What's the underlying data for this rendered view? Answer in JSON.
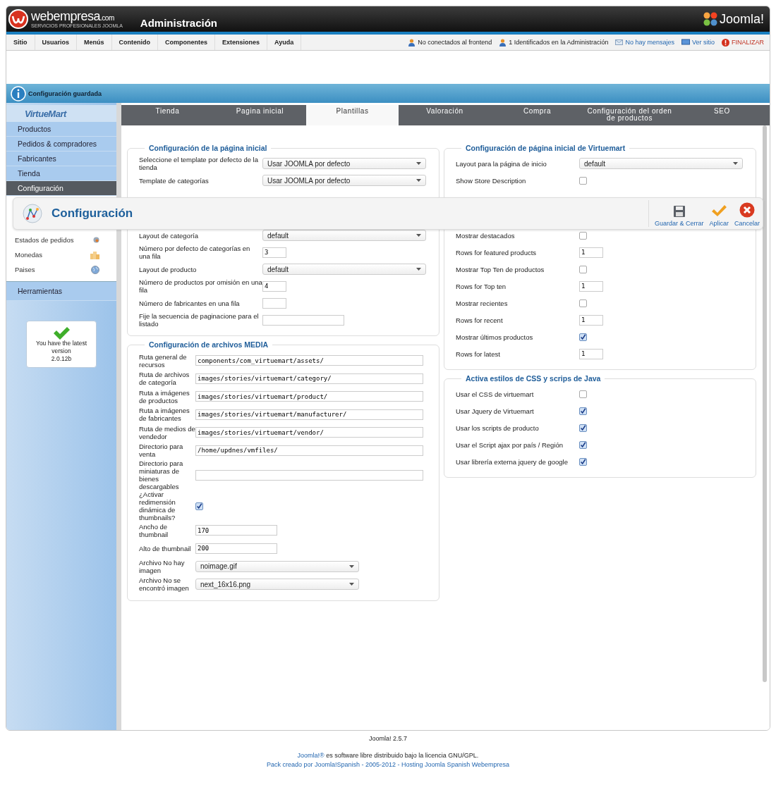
{
  "header": {
    "brand": "webempresa",
    "brand_suffix": ".com",
    "brand_tagline": "SERVICIOS PROFESIONALES JOOMLA",
    "title": "Administración",
    "product_logo": "Joomla!"
  },
  "menu": [
    "Sitio",
    "Usuarios",
    "Menús",
    "Contenido",
    "Componentes",
    "Extensiones",
    "Ayuda"
  ],
  "status_links": [
    {
      "label": "No conectados al frontend",
      "kind": "user"
    },
    {
      "label": "1 Identificados en la Administración",
      "kind": "user"
    },
    {
      "label": "No hay mensajes",
      "kind": "mail"
    },
    {
      "label": "Ver sitio",
      "kind": "screen"
    },
    {
      "label": "FINALIZAR",
      "kind": "logout"
    }
  ],
  "message": "Configuración guardada",
  "sidebar": {
    "logo": "VirtueMart",
    "items": [
      {
        "label": "Productos",
        "selected": false
      },
      {
        "label": "Pedidos & compradores",
        "selected": false
      },
      {
        "label": "Fabricantes",
        "selected": false
      },
      {
        "label": "Tienda",
        "selected": false
      },
      {
        "label": "Configuración",
        "selected": true
      }
    ],
    "subitems": [
      {
        "label": "Estados de pedidos",
        "kind": "status"
      },
      {
        "label": "Monedas",
        "kind": "currency"
      },
      {
        "label": "Paises",
        "kind": "globe"
      }
    ],
    "items_below": [
      {
        "label": "Herramientas",
        "selected": false
      }
    ],
    "version_box": {
      "text": "You have the latest version",
      "version": "2.0.12b"
    }
  },
  "toolbar": {
    "title": "Configuración",
    "buttons": [
      {
        "label": "Guardar & Cerrar",
        "kind": "save"
      },
      {
        "label": "Aplicar",
        "kind": "apply"
      },
      {
        "label": "Cancelar",
        "kind": "cancel"
      }
    ]
  },
  "tabs": [
    {
      "label": "Tienda",
      "selected": false
    },
    {
      "label": "Pagina inicial",
      "selected": false
    },
    {
      "label": "Plantillas",
      "selected": true
    },
    {
      "label": "Valoración",
      "selected": false
    },
    {
      "label": "Compra",
      "selected": false
    },
    {
      "label": "Configuración del orden de productos",
      "selected": false
    },
    {
      "label": "SEO",
      "selected": false
    }
  ],
  "left_sections": [
    {
      "title": "Configuración de la página inicial",
      "kind": "general",
      "rows": [
        {
          "label": "Seleccione el template por defecto de la tienda",
          "kind": "select",
          "value": "Usar JOOMLA por defecto"
        },
        {
          "label": "Template de categorías",
          "kind": "select",
          "value": "Usar JOOMLA por defecto"
        }
      ],
      "rows_below": [
        {
          "label": "Layout de categoría",
          "kind": "select",
          "value": "default"
        },
        {
          "label": "Número por defecto de categorías en una fila",
          "kind": "short_input",
          "value": "3"
        },
        {
          "label": "Layout de producto",
          "kind": "select",
          "value": "default"
        },
        {
          "label": "Número de productos por omisión en una fila",
          "kind": "short_input",
          "value": "4"
        },
        {
          "label": "Número de fabricantes en una fila",
          "kind": "short_input"
        },
        {
          "label": "Fije la secuencia de paginacione para el listado",
          "kind": "medium_input"
        }
      ]
    },
    {
      "title": "Configuración de archivos MEDIA",
      "kind": "paths",
      "rows": [
        {
          "label": "Ruta general de recursos",
          "kind": "input",
          "value": "components/com_virtuemart/assets/"
        },
        {
          "label": "Ruta de archivos de categoría",
          "kind": "input",
          "value": "images/stories/virtuemart/category/"
        },
        {
          "label": "Ruta a imágenes de productos",
          "kind": "input",
          "value": "images/stories/virtuemart/product/"
        },
        {
          "label": "Ruta a imágenes de fabricantes",
          "kind": "input",
          "value": "images/stories/virtuemart/manufacturer/"
        },
        {
          "label": "Ruta de medios de vendedor",
          "kind": "input",
          "value": "images/stories/virtuemart/vendor/"
        },
        {
          "label": "Directorio para venta",
          "kind": "input",
          "value": "/home/updnes/vmfiles/"
        },
        {
          "label": "Directorio para miniaturas de bienes descargables",
          "kind": "input"
        },
        {
          "label": "¿Activar redimensión dinámica de thumbnails?",
          "kind": "checkbox",
          "checked": true
        },
        {
          "label": "Ancho de thumbnail",
          "kind": "medium_input",
          "value": "170"
        },
        {
          "label": "Alto de thumbnail",
          "kind": "medium_input",
          "value": "200"
        },
        {
          "label": "Archivo No hay imagen",
          "kind": "select",
          "value": "noimage.gif"
        },
        {
          "label": "Archivo No se encontró imagen",
          "kind": "select",
          "value": "next_16x16.png"
        }
      ]
    }
  ],
  "right_sections": [
    {
      "title": "Configuración de página inicial de Virtuemart",
      "kind": "general",
      "rows": [
        {
          "label": "Layout para la página de inicio",
          "kind": "select",
          "value": "default"
        },
        {
          "label": "Show Store Description",
          "kind": "checkbox",
          "checked": false
        }
      ],
      "rows_below": [
        {
          "label": "Mostrar destacados",
          "kind": "checkbox",
          "checked": false
        },
        {
          "label": "Rows for featured products",
          "kind": "short_input",
          "value": "1"
        },
        {
          "label": "Mostrar Top Ten de productos",
          "kind": "checkbox",
          "checked": false
        },
        {
          "label": "Rows for Top ten",
          "kind": "short_input",
          "value": "1"
        },
        {
          "label": "Mostrar recientes",
          "kind": "checkbox",
          "checked": false
        },
        {
          "label": "Rows for recent",
          "kind": "short_input",
          "value": "1"
        },
        {
          "label": "Mostrar últimos productos",
          "kind": "checkbox",
          "checked": true
        },
        {
          "label": "Rows for latest",
          "kind": "short_input",
          "value": "1"
        }
      ]
    },
    {
      "title": "Activa estilos de CSS y scrips de Java",
      "kind": "general",
      "rows": [
        {
          "label": "Usar el CSS de virtuemart",
          "kind": "checkbox",
          "checked": false
        },
        {
          "label": "Usar Jquery de Virtuemart",
          "kind": "checkbox",
          "checked": true
        },
        {
          "label": "Usar los scripts de producto",
          "kind": "checkbox",
          "checked": true
        },
        {
          "label": "Usar el Script ajax por país / Región",
          "kind": "checkbox",
          "checked": true
        },
        {
          "label": "Usar librería externa jquery de google",
          "kind": "checkbox",
          "checked": true
        }
      ]
    }
  ],
  "footer": {
    "version": "Joomla! 2.5.7",
    "license_link": "Joomla!®",
    "license_text": "es software libre distribuido bajo la licencia GNU/GPL.",
    "credits": "Pack creado por Joomla!Spanish - 2005-2012 - Hosting Joomla Spanish Webempresa"
  }
}
